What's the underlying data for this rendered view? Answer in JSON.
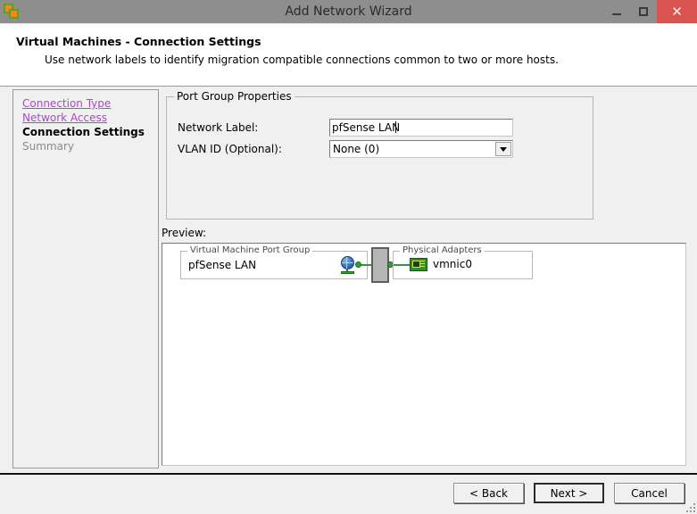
{
  "window": {
    "title": "Add Network Wizard",
    "app_icon": "vsphere-client-icon",
    "minimize_label": "",
    "maximize_label": "",
    "close_label": "✕"
  },
  "header": {
    "title": "Virtual Machines - Connection Settings",
    "subtitle": "Use network labels to identify migration compatible connections common to two or more hosts."
  },
  "sidebar": {
    "items": [
      {
        "label": "Connection Type",
        "state": "link"
      },
      {
        "label": "Network Access",
        "state": "link"
      },
      {
        "label": "Connection Settings",
        "state": "current"
      },
      {
        "label": "Summary",
        "state": "pending"
      }
    ]
  },
  "port_group_properties": {
    "group_title": "Port Group Properties",
    "network_label": {
      "label": "Network Label:",
      "value": "pfSense LAN"
    },
    "vlan_id": {
      "label": "VLAN ID (Optional):",
      "value": "None (0)",
      "arrow_icon": "chevron-down-icon"
    }
  },
  "preview": {
    "label": "Preview:",
    "vm_port_group": {
      "title": "Virtual Machine Port Group",
      "name": "pfSense LAN",
      "icon": "network-globe-icon"
    },
    "physical_adapters": {
      "title": "Physical Adapters",
      "name": "vmnic0",
      "icon": "network-adapter-icon"
    },
    "switch_icon": "virtual-switch-icon"
  },
  "footer": {
    "back_label": "< Back",
    "next_label": "Next >",
    "cancel_label": "Cancel",
    "resize_grip": "resize-grip-icon"
  },
  "colors": {
    "titlebar": "#8e8e8e",
    "close_button": "#d9534f",
    "link": "#a74ac7",
    "panel_bg": "#f0f0f0",
    "accent_green": "#33a033"
  }
}
